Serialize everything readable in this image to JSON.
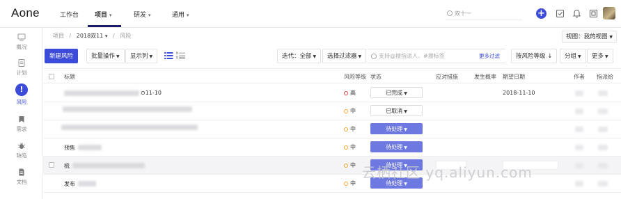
{
  "app": {
    "logo": "Aone"
  },
  "topnav": {
    "items": [
      {
        "label": "工作台",
        "caret": ""
      },
      {
        "label": "项目",
        "caret": "▾"
      },
      {
        "label": "研发",
        "caret": "▾"
      },
      {
        "label": "通用",
        "caret": "▾"
      }
    ],
    "search_value": "双十一"
  },
  "sidebar": {
    "items": [
      {
        "label": "概况",
        "icon": "overview-icon"
      },
      {
        "label": "计划",
        "icon": "plan-icon"
      },
      {
        "label": "风险",
        "icon": "risk-icon"
      },
      {
        "label": "需求",
        "icon": "requirement-icon"
      },
      {
        "label": "缺陷",
        "icon": "bug-icon"
      },
      {
        "label": "文档",
        "icon": "document-icon"
      }
    ]
  },
  "breadcrumb": {
    "root": "项目",
    "sep1": "/",
    "project": "2018双11",
    "caret": "▾",
    "sep2": "/",
    "page": "风险"
  },
  "view_selector": "视图：我的视图",
  "toolbar": {
    "new_risk": "新建风险",
    "batch": "批量操作",
    "columns": "显示列",
    "iteration": "迭代：全部",
    "filter_select": "选择过滤器",
    "search_placeholder": "支持@搜指派人、#搜标签",
    "more_filter": "更多过滤",
    "sort": "按风险等级 ↓",
    "group": "分组",
    "more": "更多"
  },
  "table": {
    "headers": {
      "title": "标题",
      "risk_level": "风险等级",
      "status": "状态",
      "measures": "应对措施",
      "probability": "发生概率",
      "due_date": "期望日期",
      "author": "作者",
      "assignee": "指派给"
    },
    "rows": [
      {
        "title_suffix": "⊙11-10",
        "risk": "高",
        "status": "已完成",
        "due": "2018-11-10"
      },
      {
        "title_suffix": "",
        "risk": "中",
        "status": "已取消",
        "due": ""
      },
      {
        "title_suffix": "",
        "risk": "中",
        "status": "待处理",
        "due": ""
      },
      {
        "title_prefix": "预售",
        "risk": "中",
        "status": "待处理",
        "due": ""
      },
      {
        "title_prefix": "梳",
        "risk": "中",
        "status": "待处理",
        "due": ""
      },
      {
        "title_prefix": "发布",
        "risk": "中",
        "status": "待处理",
        "due": ""
      }
    ]
  },
  "colors": {
    "accent": "#3d4bd9",
    "pending": "#6d78e0",
    "risk_high": "#e0464b",
    "risk_mid": "#f3a72c"
  },
  "watermark": "云栖社区 yq.aliyun.com"
}
